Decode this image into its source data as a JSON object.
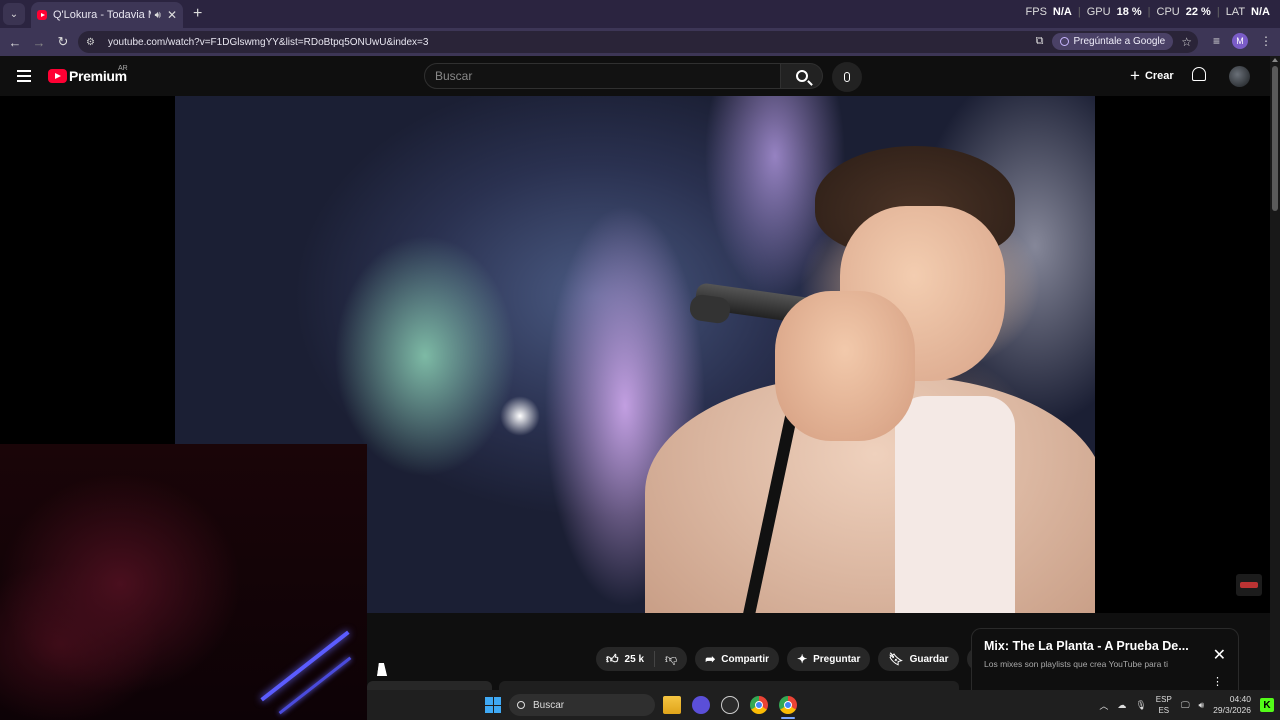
{
  "browser": {
    "tab": {
      "title": "Q'Lokura - Todavia Me Quiere"
    },
    "perf": {
      "fps_label": "FPS",
      "fps_value": "N/A",
      "gpu_label": "GPU",
      "gpu_value": "18 %",
      "cpu_label": "CPU",
      "cpu_value": "22 %",
      "lat_label": "LAT",
      "lat_value": "N/A"
    },
    "url": "youtube.com/watch?v=F1DGlswmgYY&list=RDoBtpq5ONUwU&index=3",
    "ask_google": "Pregúntale a Google",
    "profile_initial": "M"
  },
  "youtube": {
    "logo_text": "Premium",
    "country_code": "AR",
    "search_placeholder": "Buscar",
    "create_label": "Crear",
    "actions": {
      "like_count": "25 k",
      "share": "Compartir",
      "ask": "Preguntar",
      "save": "Guardar"
    },
    "mix_card": {
      "title": "Mix: The La Planta - A Prueba De...",
      "subtitle": "Los mixes son playlists que crea YouTube para ti"
    }
  },
  "taskbar": {
    "search_label": "Buscar",
    "lang_top": "ESP",
    "lang_bottom": "ES",
    "time": "04:40",
    "date": "29/3/2026"
  },
  "icons": [
    "tab-search-icon",
    "youtube-favicon-icon",
    "audio-icon",
    "close-icon",
    "new-tab-icon",
    "back-icon",
    "forward-icon",
    "reload-icon",
    "site-info-icon",
    "install-icon",
    "lens-icon",
    "star-icon",
    "media-icon",
    "menu-icon",
    "hamburger-icon",
    "search-icon",
    "mic-icon",
    "plus-icon",
    "bell-icon",
    "like-icon",
    "dislike-icon",
    "share-icon",
    "sparkle-icon",
    "bookmark-icon",
    "more-icon",
    "windows-icon",
    "folder-icon",
    "chevron-up-icon",
    "cloud-icon",
    "volume-icon",
    "kick-icon"
  ]
}
